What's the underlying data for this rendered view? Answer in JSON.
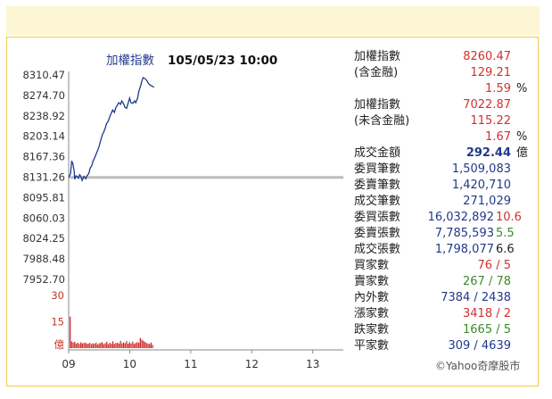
{
  "chart_data": {
    "type": "line",
    "title": "加權指數",
    "timestamp": "105/05/23 10:00",
    "y_ticks": [
      "8310.47",
      "8274.70",
      "8238.92",
      "8203.14",
      "8167.36",
      "8131.26",
      "8095.81",
      "8060.03",
      "8024.25",
      "7988.48",
      "7952.70"
    ],
    "ylim": [
      7952.7,
      8310.47
    ],
    "reference_value": 8131.26,
    "x_ticks": [
      "09",
      "10",
      "11",
      "12",
      "13"
    ],
    "xlim": [
      9.0,
      13.5
    ],
    "series": [
      {
        "x": [
          9.0,
          9.03,
          9.05,
          9.07,
          9.09,
          9.1,
          9.12,
          9.14,
          9.16,
          9.18,
          9.2,
          9.22,
          9.25,
          9.28,
          9.3,
          9.33,
          9.35,
          9.38,
          9.4,
          9.42,
          9.45,
          9.48,
          9.5,
          9.53,
          9.55,
          9.58,
          9.6,
          9.62,
          9.65,
          9.68,
          9.7,
          9.72,
          9.75,
          9.77,
          9.8,
          9.82,
          9.85,
          9.87,
          9.9,
          9.92,
          9.95,
          9.97,
          10.0,
          10.02,
          10.05,
          10.08,
          10.1,
          10.13,
          10.15,
          10.18,
          10.2,
          10.22,
          10.25,
          10.28,
          10.3,
          10.32,
          10.35,
          10.38,
          10.4
        ],
        "values": [
          8131,
          8138,
          8160,
          8155,
          8142,
          8128,
          8134,
          8133,
          8130,
          8136,
          8133,
          8126,
          8133,
          8129,
          8134,
          8138,
          8147,
          8152,
          8160,
          8164,
          8172,
          8180,
          8186,
          8198,
          8205,
          8212,
          8218,
          8225,
          8230,
          8239,
          8244,
          8249,
          8245,
          8253,
          8258,
          8262,
          8259,
          8265,
          8260,
          8254,
          8252,
          8260,
          8270,
          8262,
          8261,
          8265,
          8262,
          8270,
          8282,
          8292,
          8300,
          8306,
          8304,
          8301,
          8297,
          8294,
          8292,
          8290,
          8289
        ]
      }
    ],
    "volume": {
      "ticks": [
        "30",
        "15",
        "億"
      ],
      "ylim": [
        0,
        30
      ],
      "x_start": 9.0,
      "x_step": 0.025,
      "values": [
        18,
        3.8,
        3.2,
        3.6,
        2.6,
        3.1,
        2.4,
        3.3,
        2.7,
        2.9,
        3.1,
        2.4,
        2.6,
        3.0,
        2.2,
        2.8,
        2.5,
        3.2,
        2.0,
        2.7,
        2.9,
        3.4,
        2.3,
        2.8,
        3.6,
        2.2,
        3.0,
        2.5,
        3.9,
        2.4,
        2.9,
        3.1,
        2.6,
        4.1,
        2.7,
        3.3,
        2.8,
        4.0,
        2.5,
        3.4,
        2.6,
        3.7,
        2.4,
        2.9,
        3.5,
        3.0,
        5.8,
        4.8,
        4.2,
        3.5,
        3.0,
        2.6,
        2.3,
        3.2,
        1.9
      ]
    }
  },
  "panel": {
    "rows": [
      {
        "label": "加權指數",
        "value": "8260.47",
        "vclass": "red"
      },
      {
        "label": "(含金融)",
        "value": "129.21",
        "vclass": "red"
      },
      {
        "label": "",
        "value": "1.59",
        "vclass": "red",
        "unit": "%"
      },
      {
        "label": "加權指數",
        "lclass": "orange",
        "value": "7022.87",
        "vclass": "red"
      },
      {
        "label": "(未含金融)",
        "lclass": "orange",
        "value": "115.22",
        "vclass": "red"
      },
      {
        "label": "",
        "value": "1.67",
        "vclass": "red",
        "unit": "%"
      },
      {
        "label": "成交金額",
        "value": "292.44",
        "vclass": "blue bold",
        "unit": "億"
      },
      {
        "label": "委買筆數",
        "value": "1,509,083",
        "vclass": "blue"
      },
      {
        "label": "委賣筆數",
        "value": "1,420,710",
        "vclass": "blue"
      },
      {
        "label": "成交筆數",
        "value": "271,029",
        "vclass": "blue"
      },
      {
        "label": "委買張數",
        "value": "16,032,892",
        "vclass": "blue",
        "extra": "10.6",
        "eclass": "red"
      },
      {
        "label": "委賣張數",
        "value": "7,785,593",
        "vclass": "blue",
        "extra": "5.5",
        "eclass": "green"
      },
      {
        "label": "成交張數",
        "value": "1,798,077",
        "vclass": "blue",
        "extra": "6.6",
        "eclass": "dark"
      },
      {
        "label": "買家數",
        "value": "76 / 5",
        "vclass": "red"
      },
      {
        "label": "賣家數",
        "value": "267 / 78",
        "vclass": "green"
      },
      {
        "label": "內外數",
        "value": "7384 / 2438",
        "vclass": "blue"
      },
      {
        "label": "漲家數",
        "value": "3418 / 2",
        "vclass": "red"
      },
      {
        "label": "跌家數",
        "value": "1665 / 5",
        "vclass": "green"
      },
      {
        "label": "平家數",
        "value": "309 / 4639",
        "vclass": "blue"
      }
    ],
    "credit": "©Yahoo奇摩股市"
  },
  "colors": {
    "line": "#1f3a8a",
    "reference": "#bdbdbd",
    "volume": "#d0312d",
    "frame": "#f2c94c",
    "band": "#fdf6d5"
  }
}
